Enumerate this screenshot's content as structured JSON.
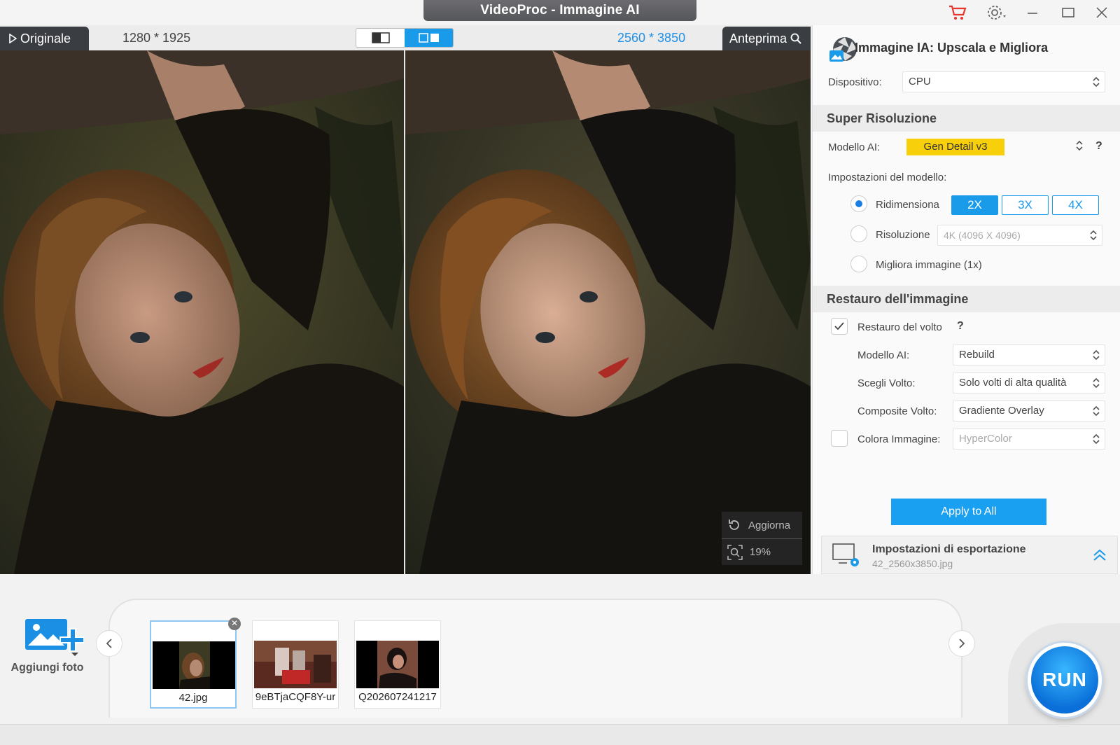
{
  "window": {
    "title": "VideoProc - Immagine AI"
  },
  "viewer": {
    "original_tab": "Originale",
    "original_dims": "1280 * 1925",
    "output_dims": "2560 * 3850",
    "preview_tab": "Anteprima",
    "refresh_label": "Aggiorna",
    "zoom_label": "19%"
  },
  "panel": {
    "title": "Immagine IA: Upscala e Migliora",
    "device_label": "Dispositivo:",
    "device_value": "CPU",
    "super_res": {
      "heading": "Super Risoluzione",
      "model_label": "Modello AI:",
      "model_value": "Gen Detail v3",
      "help": "?",
      "settings_label": "Impostazioni del modello:",
      "resize_label": "Ridimensiona",
      "scales": [
        "2X",
        "3X",
        "4X"
      ],
      "selected_scale": "2X",
      "resolution_label": "Risoluzione",
      "resolution_value": "4K (4096 X 4096)",
      "enhance_label": "Migliora immagine (1x)"
    },
    "restore": {
      "heading": "Restauro dell'immagine",
      "face_label": "Restauro del volto",
      "face_checked": true,
      "help": "?",
      "model_label": "Modello AI:",
      "model_value": "Rebuild",
      "choose_face_label": "Scegli Volto:",
      "choose_face_value": "Solo volti di alta qualità",
      "composite_label": "Composite Volto:",
      "composite_value": "Gradiente Overlay",
      "colorize_label": "Colora Immagine:",
      "colorize_checked": false,
      "colorize_value": "HyperColor"
    },
    "apply_label": "Apply to All",
    "export": {
      "title": "Impostazioni di esportazione",
      "filename": "42_2560x3850.jpg"
    }
  },
  "tray": {
    "add_label": "Aggiungi foto",
    "thumbs": [
      {
        "name": "42.jpg",
        "selected": true
      },
      {
        "name": "9eBTjaCQF8Y-ur",
        "selected": false
      },
      {
        "name": "Q202607241217",
        "selected": false
      }
    ],
    "run_label": "RUN"
  },
  "colors": {
    "accent": "#1a9bea",
    "model_badge": "#f7cf0a",
    "cart": "#e8352c"
  }
}
